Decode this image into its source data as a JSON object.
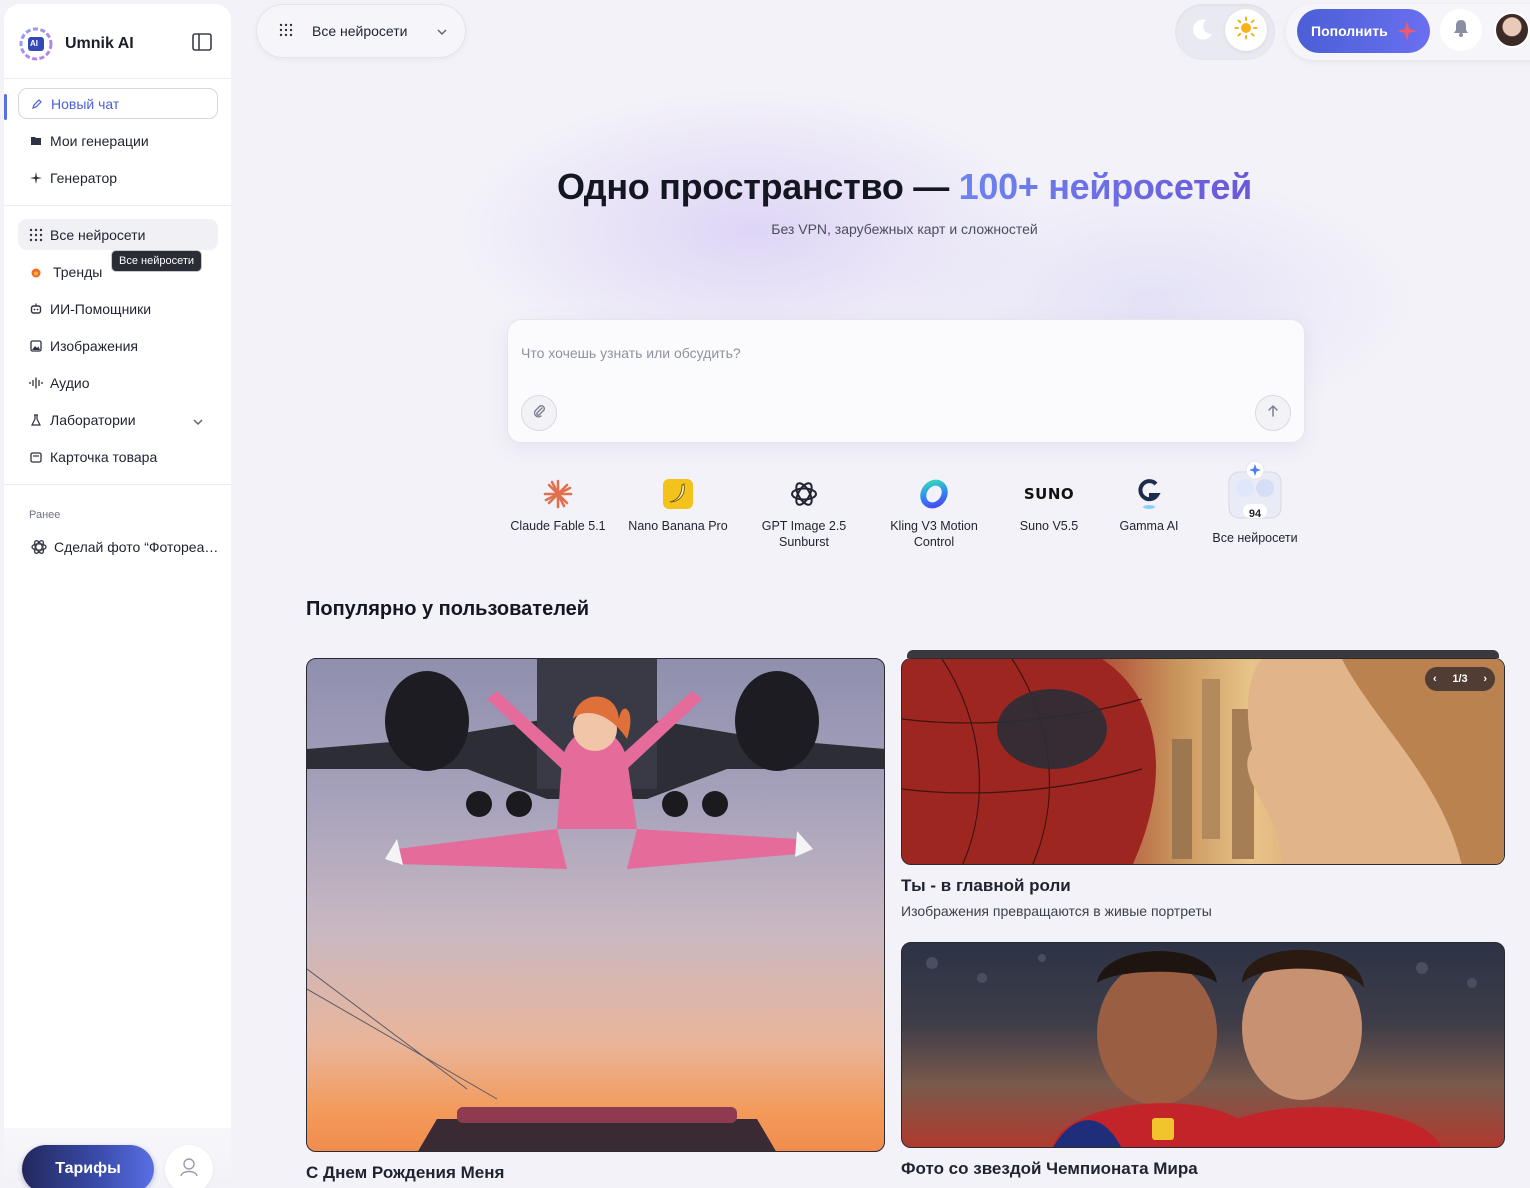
{
  "brand": {
    "name": "Umnik AI",
    "logo_text": "AI"
  },
  "sidebar": {
    "new_chat": "Новый чат",
    "my_generations": "Мои генерации",
    "generator": "Генератор",
    "items": [
      {
        "label": "Все нейросети",
        "icon": "grid-icon"
      },
      {
        "label": "Тренды",
        "icon": "fire-icon"
      },
      {
        "label": "ИИ-Помощники",
        "icon": "robot-icon"
      },
      {
        "label": "Изображения",
        "icon": "image-icon"
      },
      {
        "label": "Аудио",
        "icon": "audio-icon"
      },
      {
        "label": "Лаборатории",
        "icon": "flask-icon"
      },
      {
        "label": "Карточка товара",
        "icon": "card-icon"
      }
    ],
    "tooltip": "Все нейросети",
    "recent_label": "Ранее",
    "recent_items": [
      {
        "label": "Сделай фото “Фотореализм"
      }
    ],
    "tariff_button": "Тарифы"
  },
  "header": {
    "model_select": "Все нейросети",
    "topup_button": "Пополнить"
  },
  "hero": {
    "title_part1": "Одно пространство — ",
    "title_accent": "100+ нейросетей",
    "subtitle": "Без VPN, зарубежных карт и сложностей"
  },
  "chat": {
    "placeholder": "Что хочешь узнать или обсудить?",
    "value": ""
  },
  "models": [
    {
      "label": "Claude Fable 5.1"
    },
    {
      "label": "Nano Banana Pro"
    },
    {
      "label": "GPT Image 2.5 Sunburst"
    },
    {
      "label": "Kling V3 Motion Control"
    },
    {
      "label": "Suno V5.5",
      "logo_text": "SUNO"
    },
    {
      "label": "Gamma AI"
    },
    {
      "label": "Все нейросети",
      "badge": "94"
    }
  ],
  "popular": {
    "title": "Популярно у пользователей",
    "cards": [
      {
        "title": "С Днем Рождения Меня",
        "desc": ""
      },
      {
        "title": "Ты - в главной роли",
        "desc": "Изображения превращаются в живые портреты",
        "pager": "1/3"
      },
      {
        "title": "Фото со звездой Чемпионата Мира",
        "desc": ""
      }
    ]
  },
  "colors": {
    "accent": "#5b6fe0",
    "accent_gradient_end": "#6b57d8",
    "sidebar_bg": "#ffffff",
    "page_bg": "#f3f2f8"
  }
}
